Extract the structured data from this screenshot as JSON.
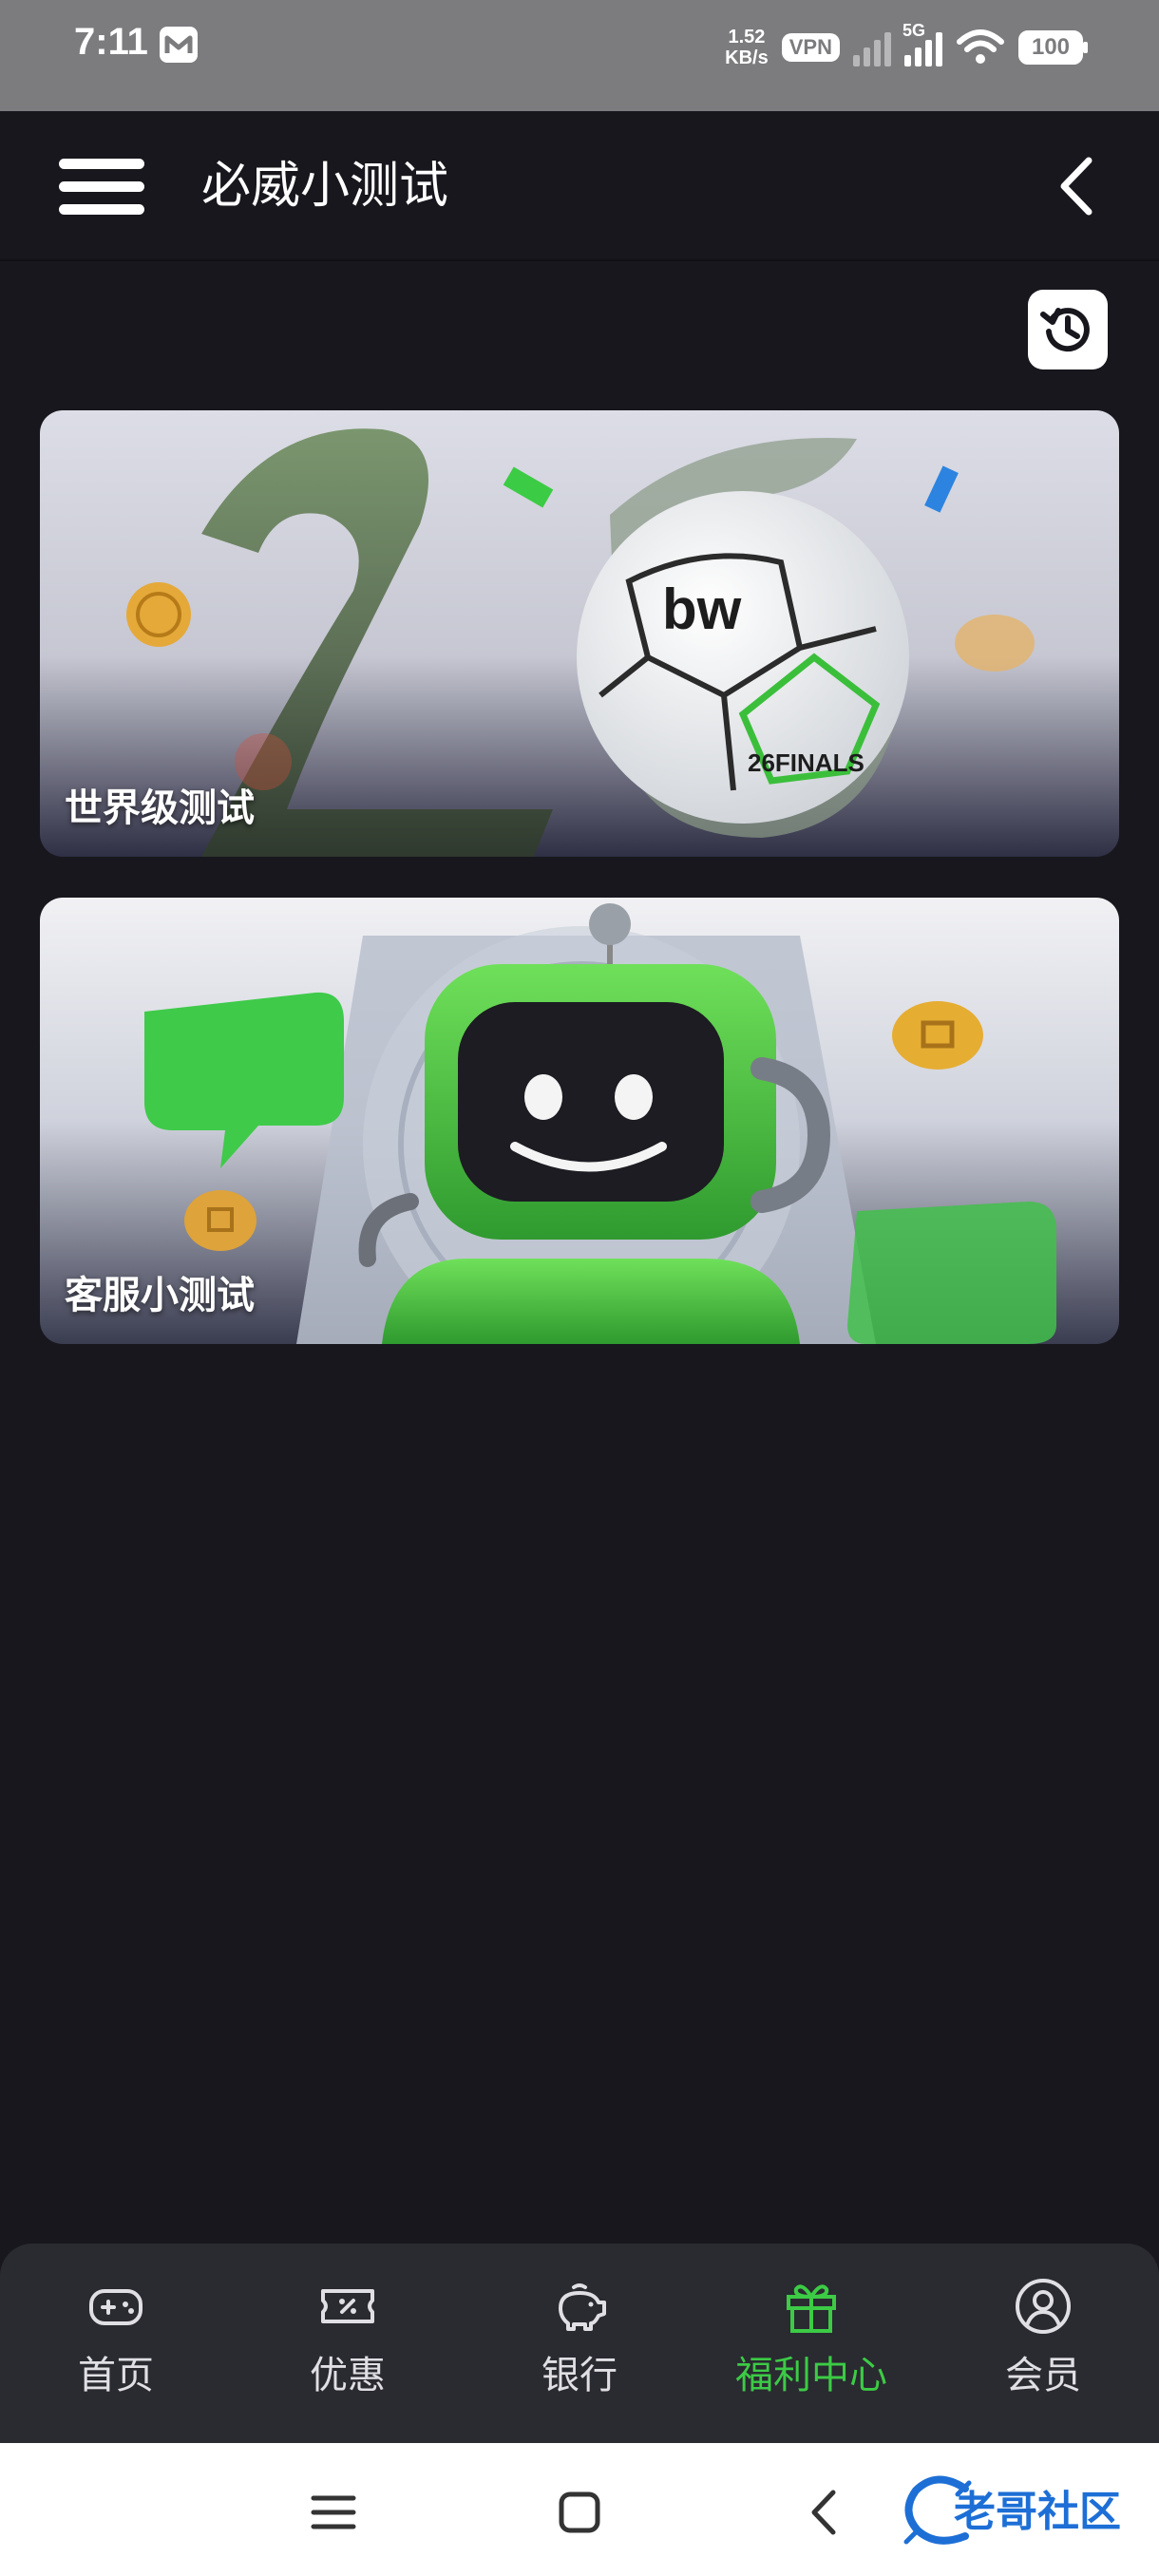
{
  "status_bar": {
    "time": "7:11",
    "net_speed_value": "1.52",
    "net_speed_unit": "KB/s",
    "vpn": "VPN",
    "network": "5G",
    "battery": "100"
  },
  "header": {
    "title": "必威小测试"
  },
  "cards": [
    {
      "label": "世界级测试",
      "art_text": "bw",
      "art_subtext": "26FINALS"
    },
    {
      "label": "客服小测试"
    }
  ],
  "bottom_nav": {
    "items": [
      {
        "label": "首页",
        "icon": "gamepad-icon",
        "active": false
      },
      {
        "label": "优惠",
        "icon": "ticket-icon",
        "active": false
      },
      {
        "label": "银行",
        "icon": "piggy-bank-icon",
        "active": false
      },
      {
        "label": "福利中心",
        "icon": "gift-icon",
        "active": true
      },
      {
        "label": "会员",
        "icon": "user-circle-icon",
        "active": false
      }
    ],
    "active_color": "#3ccb45"
  },
  "watermark": {
    "text": "老哥社区"
  },
  "colors": {
    "background": "#17171d",
    "nav_background": "#2a2a31",
    "accent_green": "#3ccb45"
  }
}
